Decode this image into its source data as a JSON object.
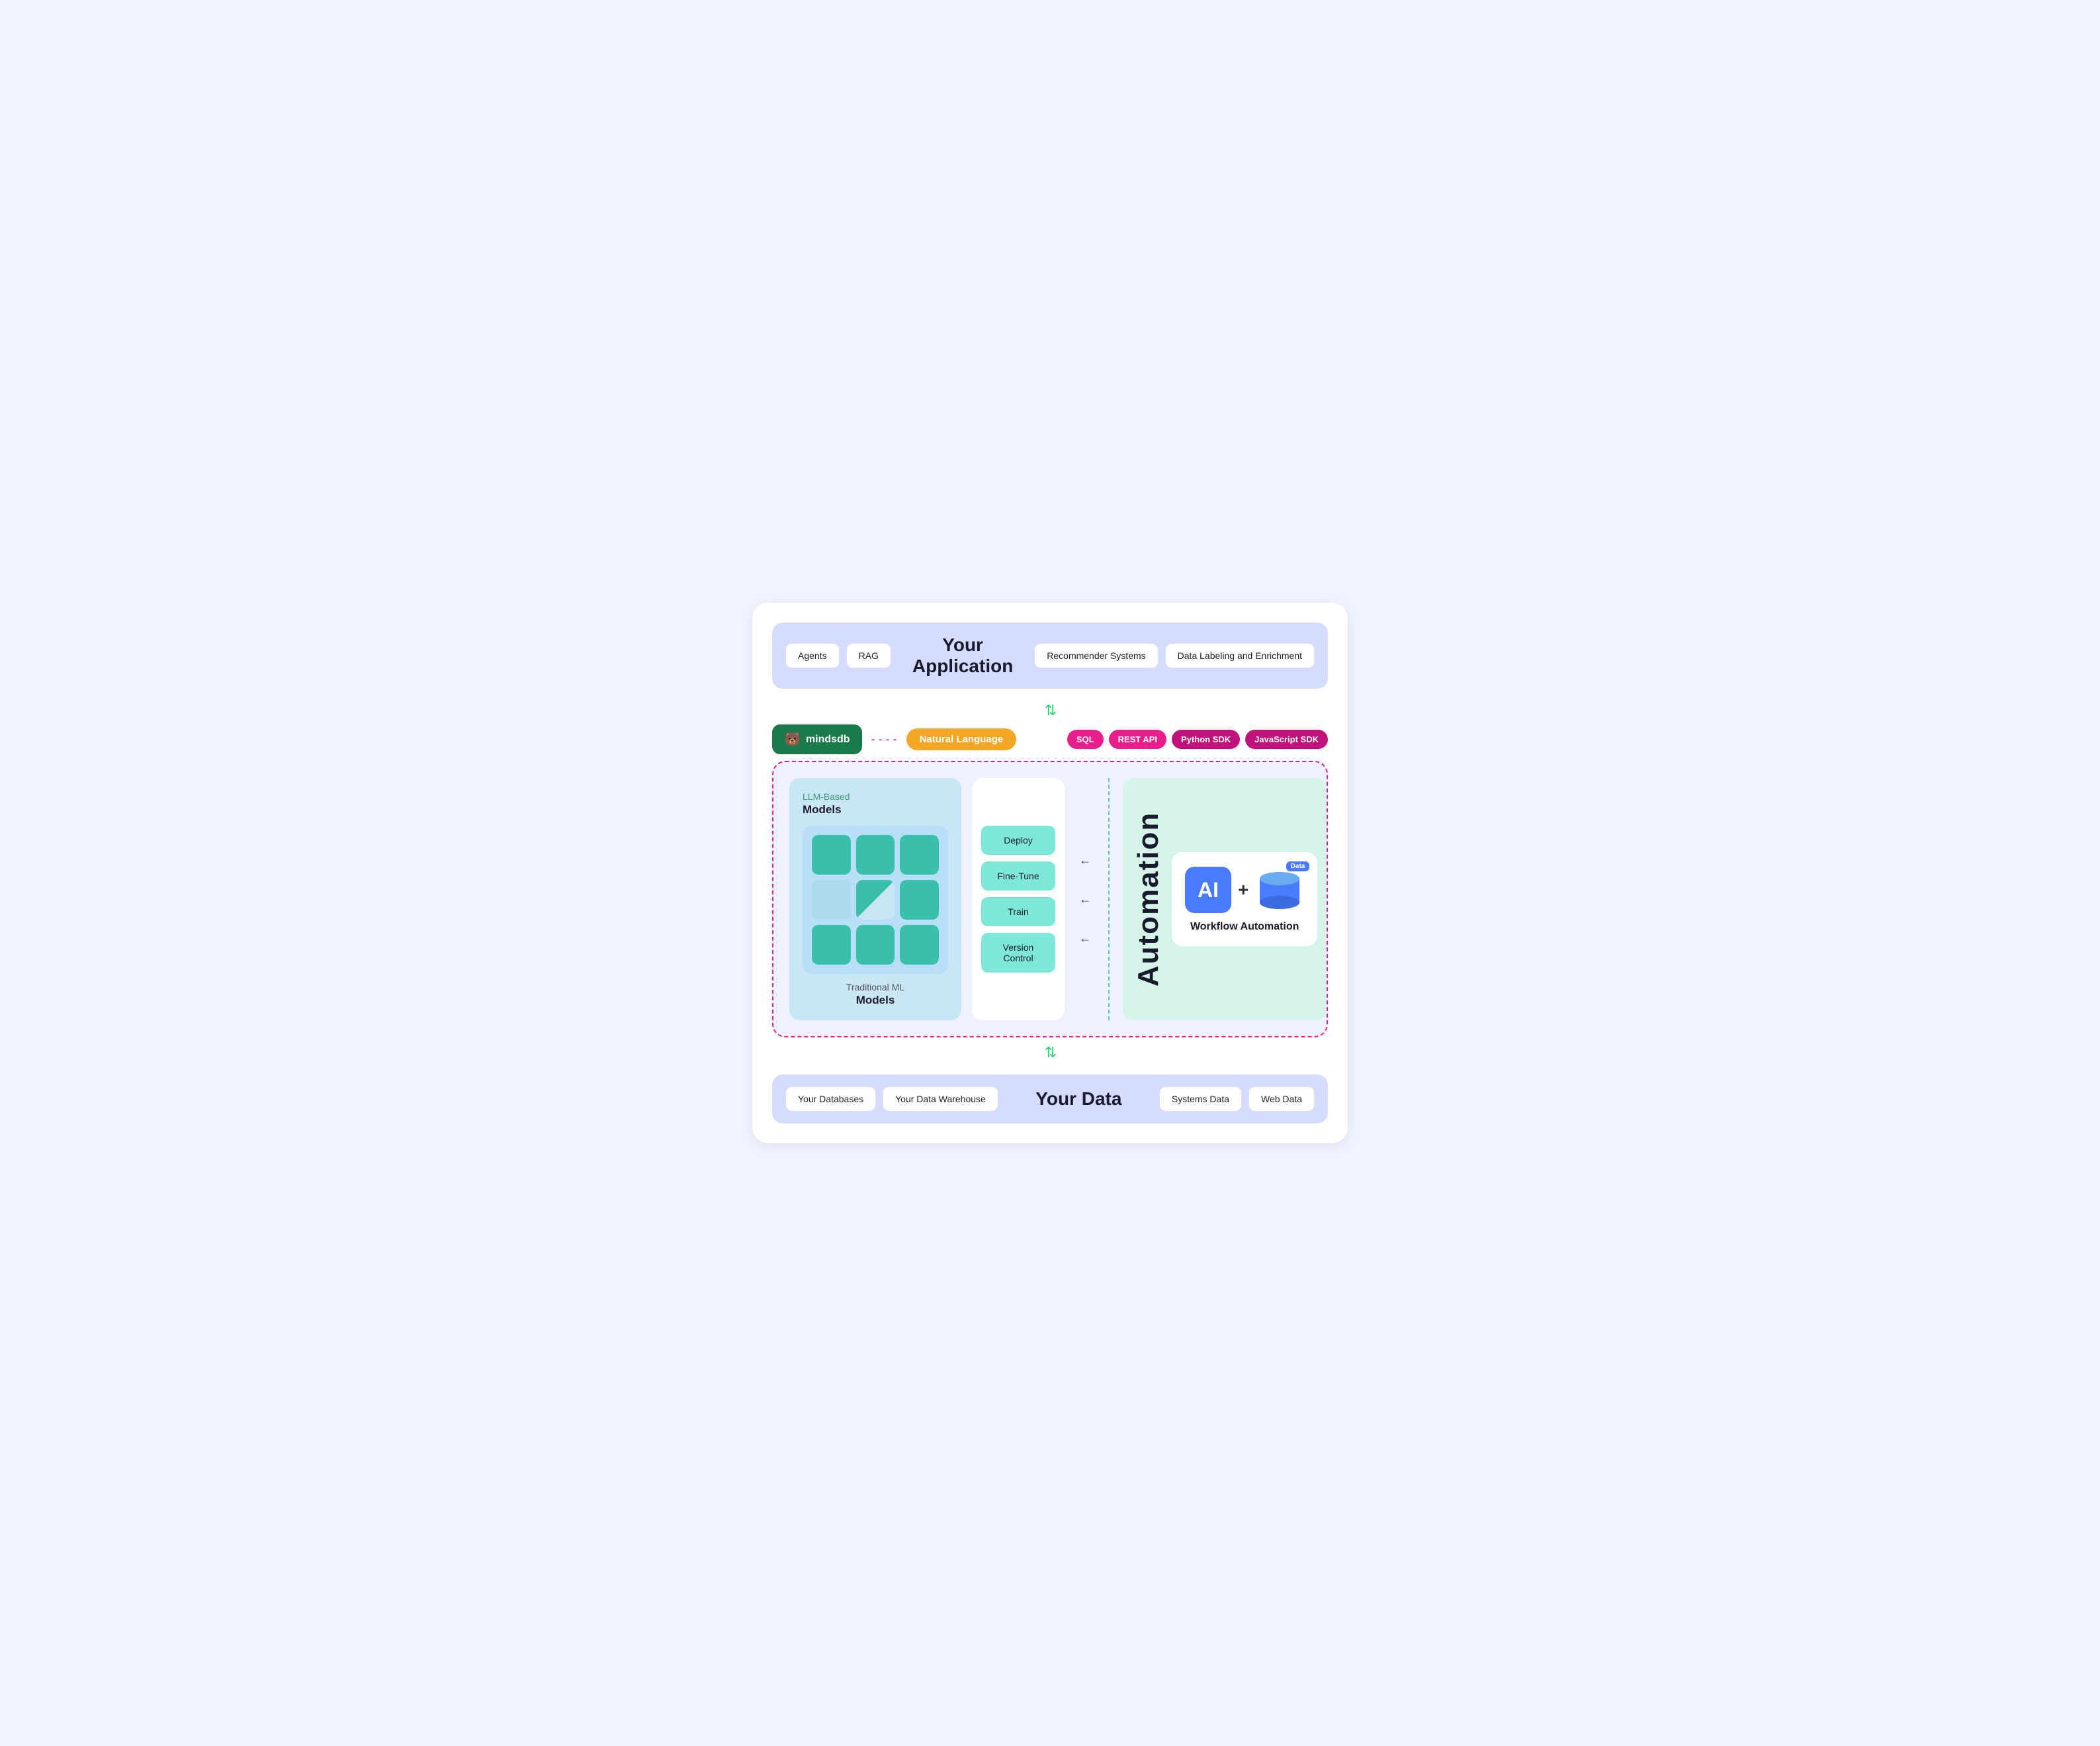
{
  "top": {
    "left_tags": [
      "Agents",
      "RAG"
    ],
    "title_line1": "Your",
    "title_line2": "Application",
    "right_tags": [
      "Recommender Systems",
      "Data Labeling and Enrichment"
    ]
  },
  "arrows": {
    "up_down": "⇅"
  },
  "mindsdb": {
    "logo_text": "mindsdb",
    "natural_language": "Natural Language",
    "sql": "SQL",
    "rest_api": "REST API",
    "python_sdk": "Python SDK",
    "js_sdk": "JavaScript SDK"
  },
  "models": {
    "llm_label": "LLM-Based",
    "llm_bold": "Models",
    "trad_label": "Traditional ML",
    "trad_bold": "Models"
  },
  "actions": {
    "buttons": [
      "Deploy",
      "Fine-Tune",
      "Train",
      "Version Control"
    ]
  },
  "automation": {
    "label": "Automation",
    "ai_label": "AI",
    "data_label": "Data",
    "workflow_label": "Workflow Automation"
  },
  "bottom": {
    "tags_left": [
      "Your Databases",
      "Your Data Warehouse"
    ],
    "title": "Your Data",
    "tags_right": [
      "Systems Data",
      "Web Data"
    ]
  }
}
